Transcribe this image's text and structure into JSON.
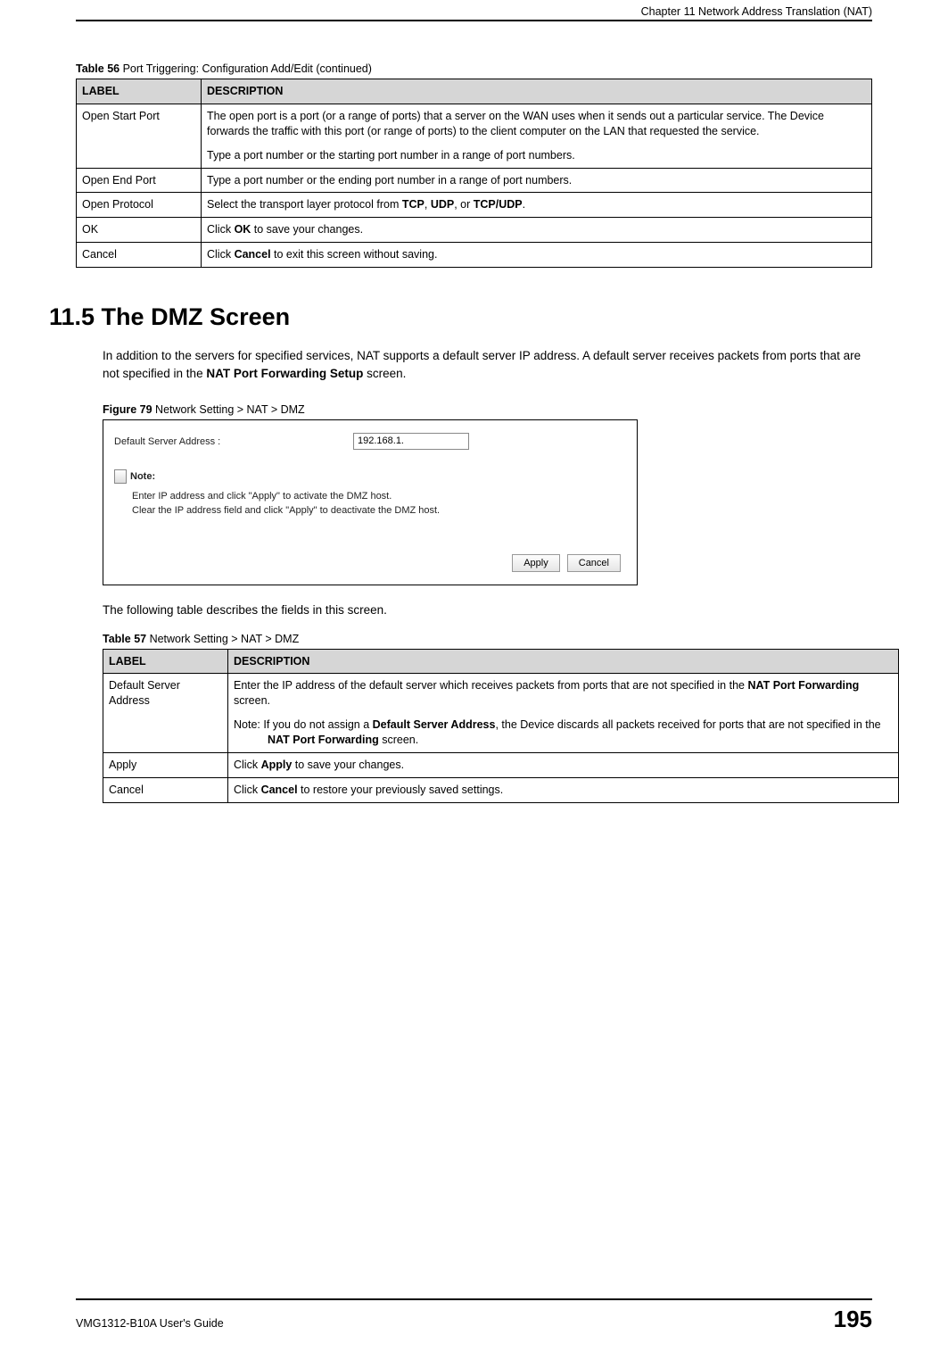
{
  "header": {
    "chapter_title": "Chapter 11 Network Address Translation (NAT)"
  },
  "table56": {
    "caption_bold": "Table 56",
    "caption_rest": "   Port Triggering: Configuration Add/Edit (continued)",
    "header_label": "LABEL",
    "header_desc": "DESCRIPTION",
    "rows": [
      {
        "label": "Open Start Port",
        "desc_p1": "The open port is a port (or a range of ports) that a server on the WAN uses when it sends out a particular service. The Device forwards the traffic with this port (or range of ports) to the client computer on the LAN that requested the service.",
        "desc_p2": "Type a port number or the starting port number in a range of port numbers."
      },
      {
        "label": "Open End Port",
        "desc_p1": "Type a port number or the ending port number in a range of port numbers."
      },
      {
        "label": "Open Protocol",
        "desc_pre": "Select the transport layer protocol from ",
        "b1": "TCP",
        "mid1": ", ",
        "b2": "UDP",
        "mid2": ", or ",
        "b3": "TCP/UDP",
        "end": "."
      },
      {
        "label": "OK",
        "desc_pre": "Click ",
        "b1": "OK",
        "end": " to save your changes."
      },
      {
        "label": "Cancel",
        "desc_pre": "Click ",
        "b1": "Cancel",
        "end": " to exit this screen without saving."
      }
    ]
  },
  "section": {
    "heading": "11.5  The DMZ Screen",
    "body_pre": "In addition to the servers for specified services, NAT supports a default server IP address. A default server receives packets from ports that are not specified in the ",
    "body_bold": "NAT Port Forwarding Setup",
    "body_post": " screen."
  },
  "figure": {
    "caption_bold": "Figure 79",
    "caption_rest": "   Network Setting > NAT > DMZ",
    "field_label": "Default Server Address :",
    "field_value": "192.168.1.",
    "note_label": "Note:",
    "note_line1": "Enter IP address and click \"Apply\" to activate the DMZ host.",
    "note_line2": "Clear the IP address field and click \"Apply\" to deactivate the DMZ host.",
    "btn_apply": "Apply",
    "btn_cancel": "Cancel"
  },
  "mid_text": "The following table describes the fields in this screen.",
  "table57": {
    "caption_bold": "Table 57",
    "caption_rest": "   Network Setting > NAT > DMZ",
    "header_label": "LABEL",
    "header_desc": "DESCRIPTION",
    "rows": [
      {
        "label": "Default Server Address",
        "p1_pre": "Enter the IP address of the default server which receives packets from ports that are not specified in the ",
        "p1_b": "NAT Port Forwarding",
        "p1_post": " screen.",
        "note_pre": "Note: If you do not assign a ",
        "note_b1": "Default Server Address",
        "note_mid": ", the Device discards all packets received for ports that are not specified in the ",
        "note_b2": "NAT Port Forwarding",
        "note_post": " screen."
      },
      {
        "label": "Apply",
        "pre": "Click ",
        "b": "Apply",
        "post": " to save your changes."
      },
      {
        "label": "Cancel",
        "pre": "Click ",
        "b": "Cancel",
        "post": " to restore your previously saved settings."
      }
    ]
  },
  "footer": {
    "guide": "VMG1312-B10A User's Guide",
    "page": "195"
  }
}
